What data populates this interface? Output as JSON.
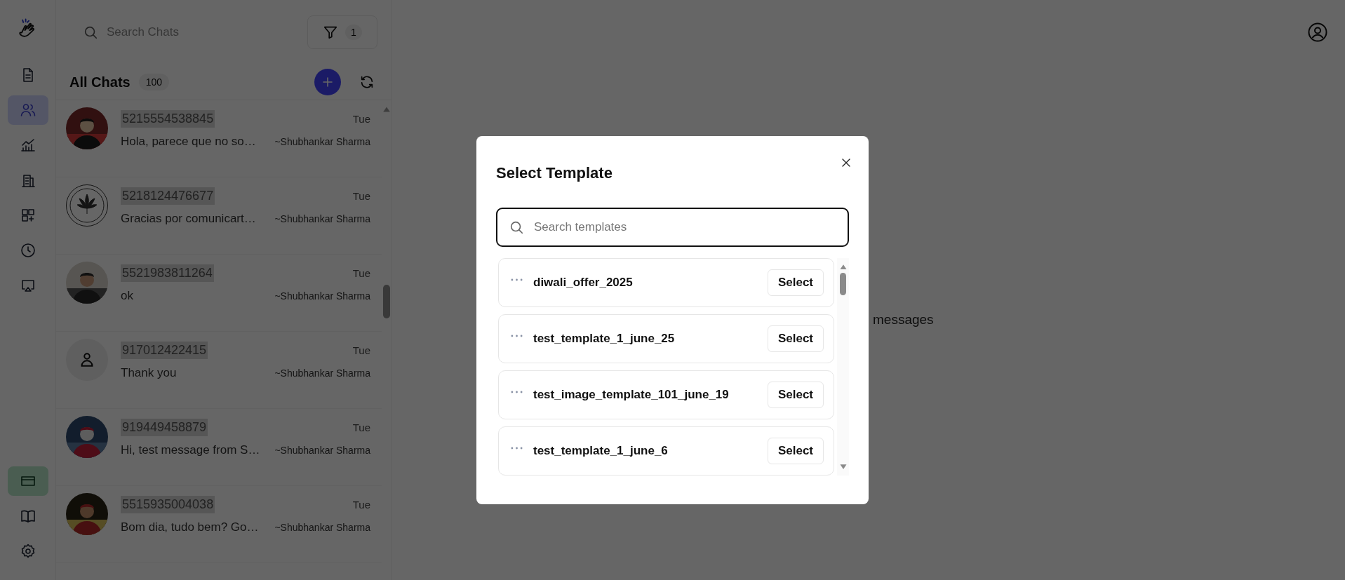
{
  "nav_top": [
    {
      "kind": "document",
      "selected": false
    },
    {
      "kind": "users",
      "selected": true
    },
    {
      "kind": "chart",
      "selected": false
    },
    {
      "kind": "report",
      "selected": false
    },
    {
      "kind": "grid-plus",
      "selected": false
    },
    {
      "kind": "clock",
      "selected": false
    },
    {
      "kind": "cast",
      "selected": false
    }
  ],
  "nav_bottom": [
    {
      "kind": "card",
      "selected": true
    },
    {
      "kind": "book",
      "selected": false
    },
    {
      "kind": "settings",
      "selected": false
    }
  ],
  "chat_search": {
    "placeholder": "Search Chats"
  },
  "filter": {
    "count": "1"
  },
  "chat_list": {
    "title": "All Chats",
    "count": "100"
  },
  "chats": [
    {
      "kind": "picture",
      "name": "5215554538845",
      "preview": "Hola, parece que no so…",
      "time": "Tue",
      "author": "~Shubhankar Sharma"
    },
    {
      "kind": "logo",
      "name": "5218124476677",
      "preview": "Gracias por comunicart…",
      "time": "Tue",
      "author": "~Shubhankar Sharma"
    },
    {
      "kind": "picture",
      "name": "5521983811264",
      "preview": "ok",
      "time": "Tue",
      "author": "~Shubhankar Sharma"
    },
    {
      "kind": "placeholder",
      "name": "917012422415",
      "preview": "Thank you",
      "time": "Tue",
      "author": "~Shubhankar Sharma"
    },
    {
      "kind": "picture",
      "name": "919449458879",
      "preview": "Hi, test message from S…",
      "time": "Tue",
      "author": "~Shubhankar Sharma"
    },
    {
      "kind": "picture",
      "name": "5515935004038",
      "preview": "Bom dia, tudo bem? Go…",
      "time": "Tue",
      "author": "~Shubhankar Sharma"
    }
  ],
  "main": {
    "empty_text": "messages"
  },
  "modal": {
    "title": "Select Template",
    "search": {
      "placeholder": "Search templates"
    },
    "templates": [
      {
        "name": "diwali_offer_2025",
        "button": "Select"
      },
      {
        "name": "test_template_1_june_25",
        "button": "Select"
      },
      {
        "name": "test_image_template_101_june_19",
        "button": "Select"
      },
      {
        "name": "test_template_1_june_6",
        "button": "Select"
      }
    ]
  }
}
